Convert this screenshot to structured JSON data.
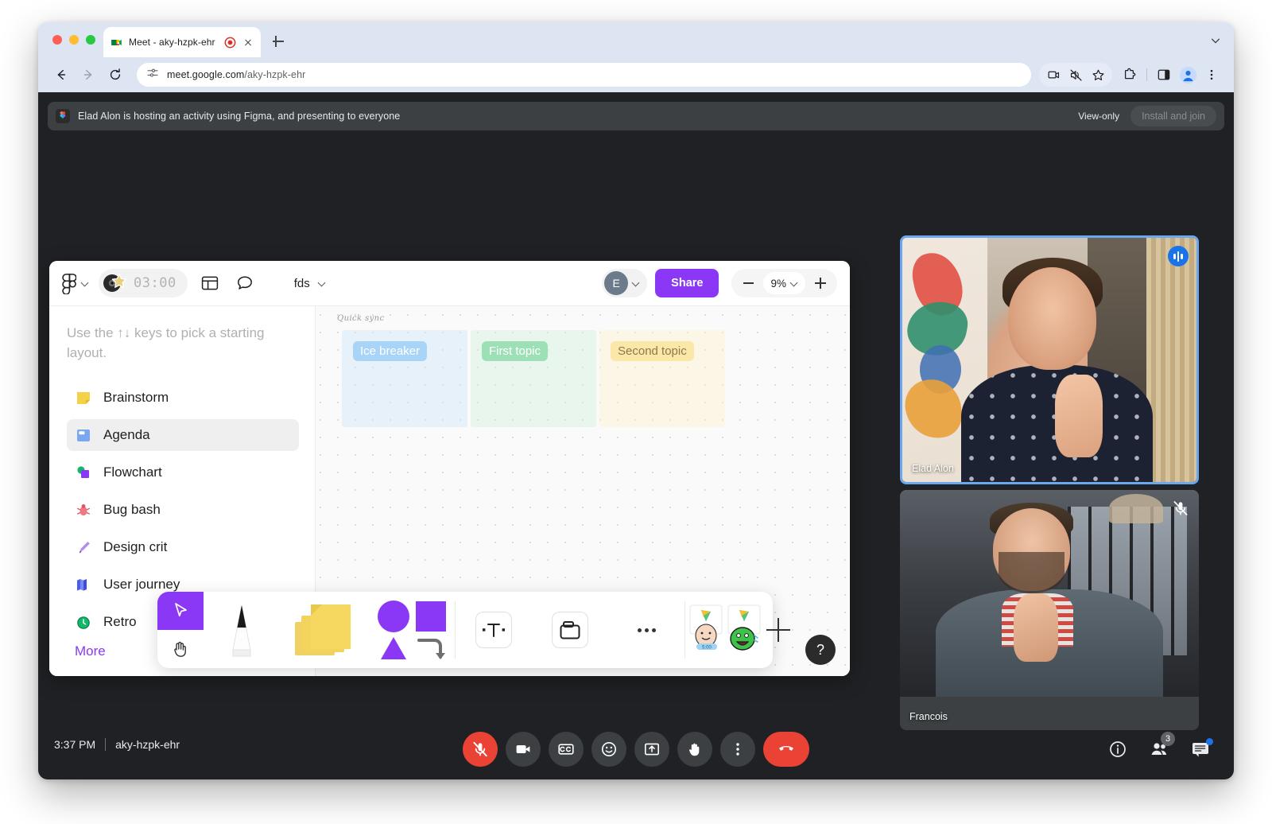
{
  "browser": {
    "tab": {
      "title": "Meet - aky-hzpk-ehr",
      "favicon_icon": "google-meet-icon",
      "recording_icon": "recording-indicator-icon",
      "close_icon": "close-icon"
    },
    "new_tab_icon": "plus-icon",
    "nav": {
      "back_icon": "back-arrow-icon",
      "forward_icon": "forward-arrow-icon",
      "reload_icon": "reload-icon"
    },
    "url": {
      "site_info_icon": "site-settings-icon",
      "host": "meet.google.com",
      "path": "/aky-hzpk-ehr",
      "full": "meet.google.com/aky-hzpk-ehr"
    },
    "toolbar_icons": [
      "screen-share-icon",
      "mute-tab-icon",
      "bookmark-star-icon",
      "extensions-puzzle-icon",
      "side-panel-icon",
      "profile-avatar-icon",
      "more-menu-icon"
    ],
    "window_controls": [
      "close-red",
      "minimize-yellow",
      "maximize-green"
    ],
    "tab_list_icon": "chevron-down-icon"
  },
  "notification": {
    "app_icon": "figma-icon",
    "text": "Elad Alon is hosting an activity using Figma, and presenting to everyone",
    "view_only_label": "View-only",
    "install_button_label": "Install and join"
  },
  "figma": {
    "logo_icon": "figma-logo-icon",
    "menu_chevron_icon": "chevron-down-icon",
    "timer": {
      "value": "03:00",
      "badge_icon": "music-star-badge-icon"
    },
    "toolbar_icons": [
      "layout-panel-icon",
      "comment-bubble-icon"
    ],
    "file_name": "fds",
    "file_chevron_icon": "chevron-down-icon",
    "avatar_initial": "E",
    "avatar_chevron_icon": "chevron-down-icon",
    "share_label": "Share",
    "zoom": {
      "minus_icon": "minus-icon",
      "value": "9%",
      "chevron_icon": "chevron-down-icon",
      "plus_icon": "plus-icon"
    },
    "left_pane": {
      "hint": "Use the ↑↓ keys to pick a starting layout.",
      "items": [
        {
          "label": "Brainstorm",
          "icon": "sticky-note-icon",
          "selected": false
        },
        {
          "label": "Agenda",
          "icon": "agenda-board-icon",
          "selected": true
        },
        {
          "label": "Flowchart",
          "icon": "flowchart-icon",
          "selected": false
        },
        {
          "label": "Bug bash",
          "icon": "bug-icon",
          "selected": false
        },
        {
          "label": "Design crit",
          "icon": "pen-nib-icon",
          "selected": false
        },
        {
          "label": "User journey",
          "icon": "map-icon",
          "selected": false
        },
        {
          "label": "Retro",
          "icon": "clock-icon",
          "selected": false
        }
      ],
      "more_label": "More"
    },
    "board": {
      "title": "Quick sync",
      "columns": [
        {
          "label": "Ice breaker",
          "color": "#a8d4f7"
        },
        {
          "label": "First topic",
          "color": "#9ee0b6"
        },
        {
          "label": "Second topic",
          "color": "#fbe8a8"
        }
      ]
    },
    "tools": [
      {
        "name": "cursor-tool",
        "icon": "cursor-arrow-icon",
        "active": true
      },
      {
        "name": "hand-tool",
        "icon": "hand-icon",
        "active": false
      },
      {
        "name": "pen-tool",
        "icon": "marker-pen-icon",
        "active": false
      },
      {
        "name": "sticky-note-tool",
        "icon": "sticky-notes-icon",
        "active": false
      },
      {
        "name": "shapes-tool",
        "icon": "shapes-icon",
        "active": false
      },
      {
        "name": "text-tool",
        "icon": "text-t-icon",
        "active": false
      },
      {
        "name": "section-tool",
        "icon": "section-frame-icon",
        "active": false
      },
      {
        "name": "more-tools",
        "icon": "ellipsis-icon",
        "active": false
      },
      {
        "name": "stamp-one",
        "icon": "party-face-sticker-icon",
        "active": false
      },
      {
        "name": "stamp-two",
        "icon": "party-monster-sticker-icon",
        "active": false
      },
      {
        "name": "add-stamp",
        "icon": "plus-icon",
        "active": false
      }
    ],
    "help_label": "?",
    "accent_color": "#8a38f5"
  },
  "participants": [
    {
      "name": "Elad Alon",
      "speaking": true,
      "muted": false,
      "badge_icon": "speaking-waveform-icon"
    },
    {
      "name": "Francois",
      "speaking": false,
      "muted": true,
      "badge_icon": "mic-off-icon"
    }
  ],
  "meet_bar": {
    "time": "3:37 PM",
    "meeting_code": "aky-hzpk-ehr",
    "controls": [
      {
        "name": "microphone-button",
        "icon": "mic-off-icon",
        "state": "muted",
        "color": "#ea4335"
      },
      {
        "name": "camera-button",
        "icon": "video-camera-icon",
        "state": "on",
        "color": "#3c4043"
      },
      {
        "name": "captions-button",
        "icon": "closed-captions-icon",
        "state": "off",
        "color": "#3c4043"
      },
      {
        "name": "reactions-button",
        "icon": "emoji-smiley-icon",
        "state": "off",
        "color": "#3c4043"
      },
      {
        "name": "present-button",
        "icon": "present-screen-icon",
        "state": "off",
        "color": "#3c4043"
      },
      {
        "name": "raise-hand-button",
        "icon": "raised-hand-icon",
        "state": "off",
        "color": "#3c4043"
      },
      {
        "name": "more-options-button",
        "icon": "more-vertical-icon",
        "state": "off",
        "color": "#3c4043"
      },
      {
        "name": "end-call-button",
        "icon": "phone-hangup-icon",
        "state": "on",
        "color": "#ea4335"
      }
    ],
    "right_controls": [
      {
        "name": "meeting-details-button",
        "icon": "info-circle-icon",
        "badge": ""
      },
      {
        "name": "participants-button",
        "icon": "people-icon",
        "badge": "3"
      },
      {
        "name": "chat-button",
        "icon": "chat-bubble-icon",
        "badge": "dot"
      }
    ]
  },
  "colors": {
    "meet_background": "#202124",
    "notification_background": "#3c4043",
    "figma_purple": "#8a38f5",
    "danger_red": "#ea4335",
    "speaking_blue": "#1a73e8",
    "tile_border_blue": "#6ba7ef"
  }
}
